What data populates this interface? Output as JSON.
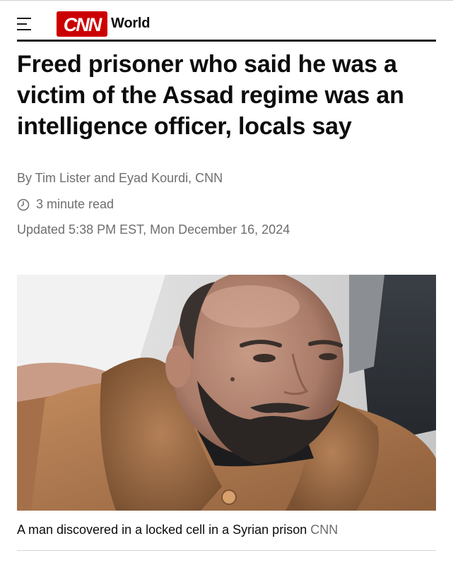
{
  "header": {
    "menu_icon": "hamburger-menu-icon",
    "logo_text": "CNN",
    "section": "World",
    "brand_color": "#cc0000"
  },
  "article": {
    "headline": "Freed prisoner who said he was a victim of the Assad regime was an intelligence officer, locals say",
    "byline": "By Tim Lister and Eyad Kourdi, CNN",
    "read_time": "3 minute read",
    "read_time_icon": "clock-icon",
    "updated": "Updated 5:38 PM EST, Mon December 16, 2024"
  },
  "media": {
    "caption": "A man discovered in a locked cell in a Syrian prison",
    "credit": "CNN"
  }
}
